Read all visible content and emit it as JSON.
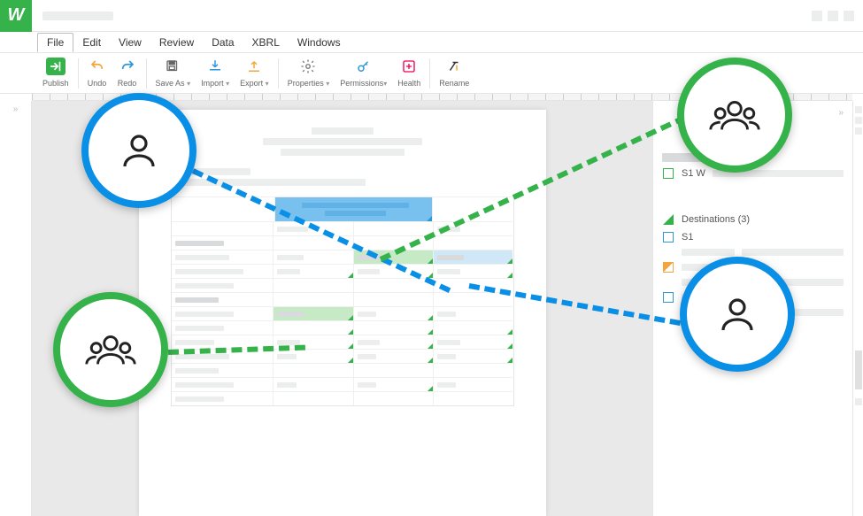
{
  "menubar": {
    "items": [
      "File",
      "Edit",
      "View",
      "Review",
      "Data",
      "XBRL",
      "Windows"
    ],
    "active_index": 0
  },
  "toolbar": {
    "publish": "Publish",
    "undo": "Undo",
    "redo": "Redo",
    "save_as": "Save As",
    "import": "Import",
    "export": "Export",
    "properties": "Properties",
    "permissions": "Permissions",
    "health": "Health",
    "rename": "Rename"
  },
  "rightpanel": {
    "s1w_label": "S1 W",
    "destinations_label": "Destinations (3)",
    "s1_label": "S1"
  },
  "colors": {
    "brand_green": "#35b34a",
    "accent_blue": "#0a8fe6"
  }
}
